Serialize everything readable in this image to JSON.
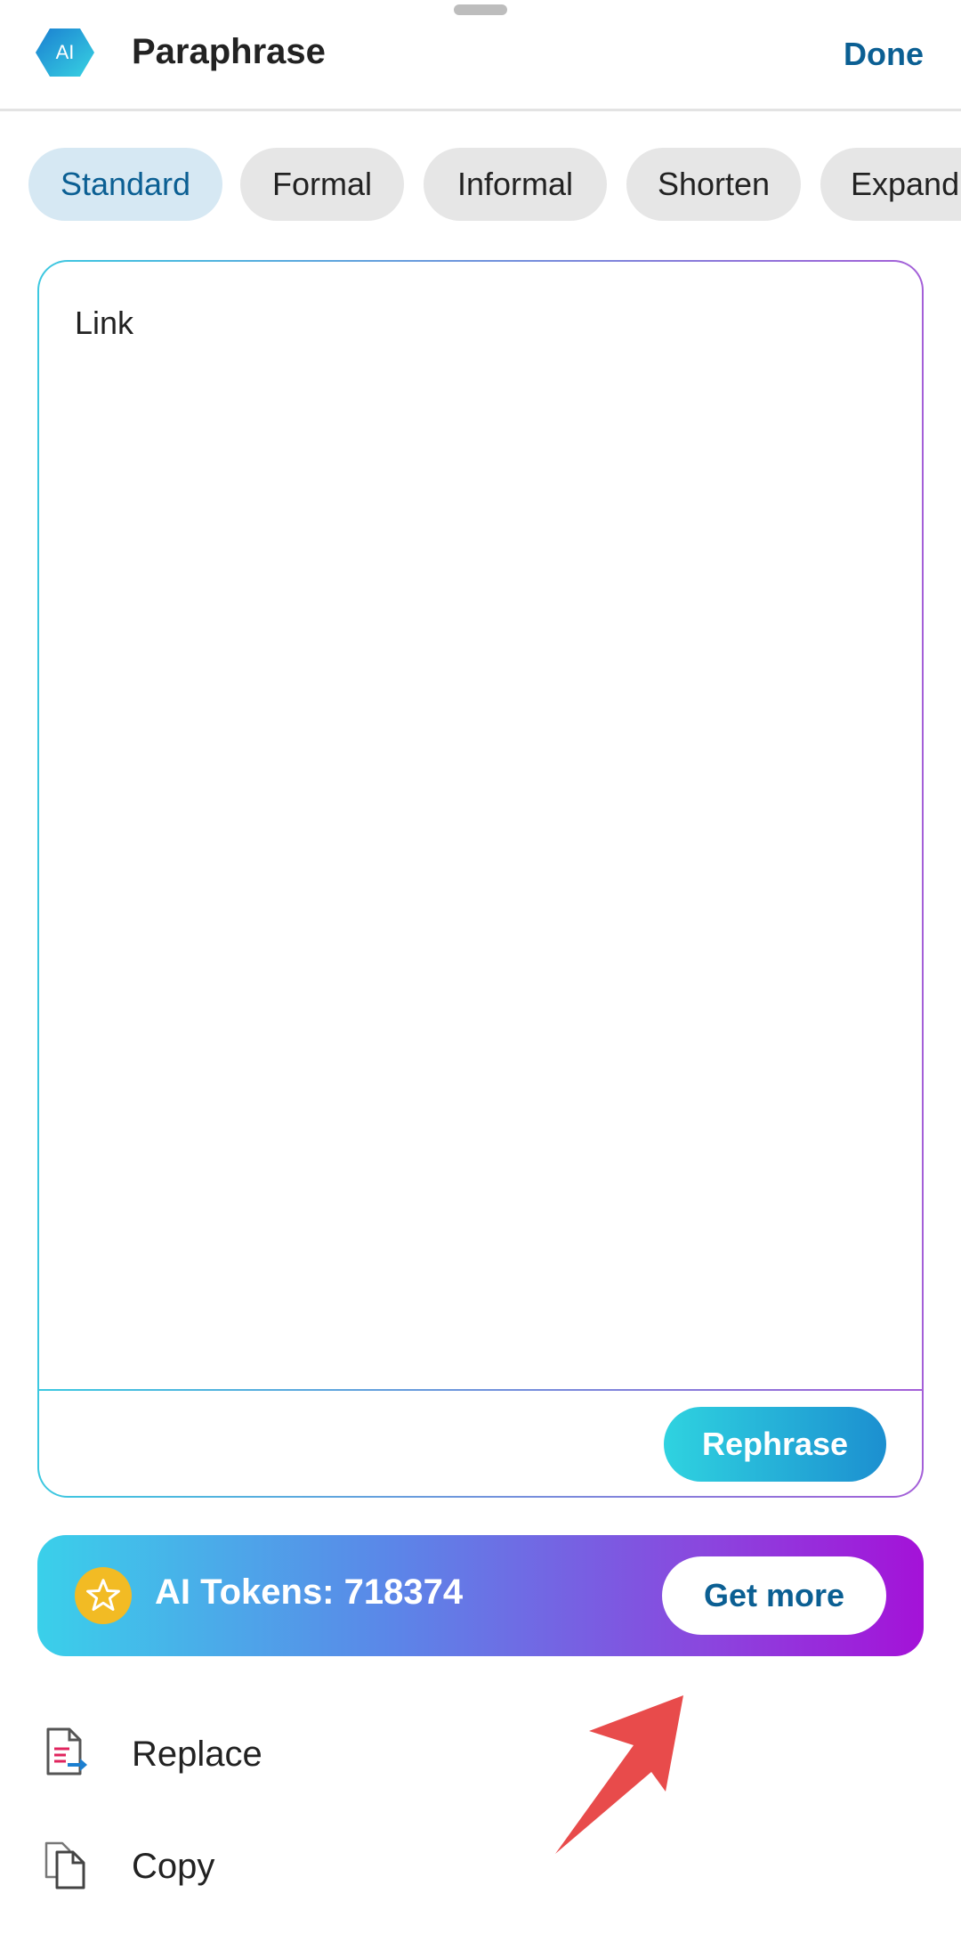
{
  "header": {
    "logo_text": "AI",
    "title": "Paraphrase",
    "done_label": "Done"
  },
  "modes": [
    {
      "label": "Standard",
      "active": true
    },
    {
      "label": "Formal",
      "active": false
    },
    {
      "label": "Informal",
      "active": false
    },
    {
      "label": "Shorten",
      "active": false
    },
    {
      "label": "Expand",
      "active": false
    }
  ],
  "editor": {
    "text": "Link",
    "rephrase_label": "Rephrase"
  },
  "tokens": {
    "label": "AI Tokens: 718374",
    "get_more_label": "Get more",
    "icon": "star-icon"
  },
  "actions": [
    {
      "label": "Replace",
      "icon": "replace-document-icon"
    },
    {
      "label": "Copy",
      "icon": "copy-icon"
    }
  ],
  "colors": {
    "accent": "#0b5f93",
    "active_chip_bg": "#d6e8f3",
    "chip_bg": "#e6e6e6",
    "annotation_arrow": "#e84b4b"
  }
}
